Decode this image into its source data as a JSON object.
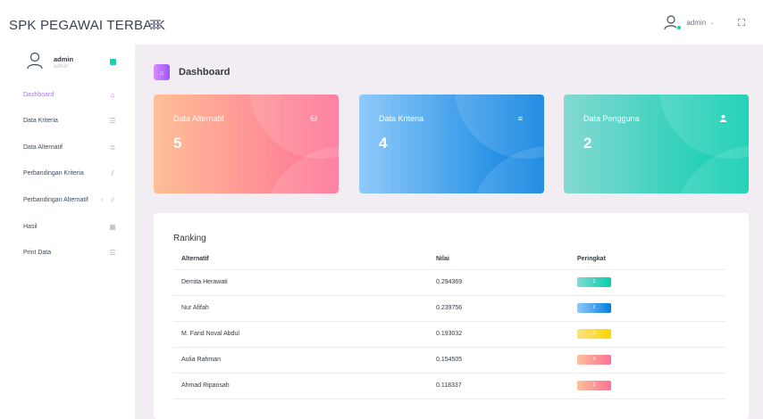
{
  "brand": "SPK PEGAWAI TERBAIK",
  "topbar": {
    "user": "admin",
    "caret": "⌄"
  },
  "profile": {
    "name": "admin",
    "role": "admin"
  },
  "sidebar": {
    "items": [
      {
        "label": "Dashboard",
        "icon": "home-icon",
        "glyph": "⌂"
      },
      {
        "label": "Data Kriteria",
        "icon": "list-icon",
        "glyph": "☰"
      },
      {
        "label": "Data Alternatif",
        "icon": "database-icon",
        "glyph": "≣"
      },
      {
        "label": "Perbandingan Kriteria",
        "icon": "compare-icon",
        "glyph": "⫽"
      },
      {
        "label": "Perbandingan Alternatif",
        "icon": "compare-icon",
        "glyph": "⫽",
        "arrow": "‹"
      },
      {
        "label": "Hasil",
        "icon": "grid-icon",
        "glyph": "▦"
      },
      {
        "label": "Print Data",
        "icon": "list-icon",
        "glyph": "☰"
      }
    ]
  },
  "page": {
    "title": "Dashboard"
  },
  "cards": [
    {
      "title": "Data Alternatif",
      "value": "5",
      "icon": "database-icon",
      "glyph": "⛁"
    },
    {
      "title": "Data Kriteria",
      "value": "4",
      "icon": "list-icon",
      "glyph": "≡"
    },
    {
      "title": "Data Pengguna",
      "value": "2",
      "icon": "user-icon",
      "glyph": "👤"
    }
  ],
  "ranking": {
    "title": "Ranking",
    "headers": [
      "Alternatif",
      "Nilai",
      "Peringkat"
    ],
    "rows": [
      {
        "name": "Demita Herawati",
        "score": "0.294369",
        "rank": "1"
      },
      {
        "name": "Nur Afifah",
        "score": "0.239756",
        "rank": "2"
      },
      {
        "name": "M. Farid Noval Abdul",
        "score": "0.193032",
        "rank": "3"
      },
      {
        "name": "Aulia Rahman",
        "score": "0.154505",
        "rank": "4"
      },
      {
        "name": "Ahmad Ripansah",
        "score": "0.118337",
        "rank": "5"
      }
    ]
  },
  "colors": {
    "accent": "#b66dff",
    "success": "#07cdae",
    "info": "#047edf",
    "warning": "#ffd500",
    "danger": "#fe7096"
  }
}
